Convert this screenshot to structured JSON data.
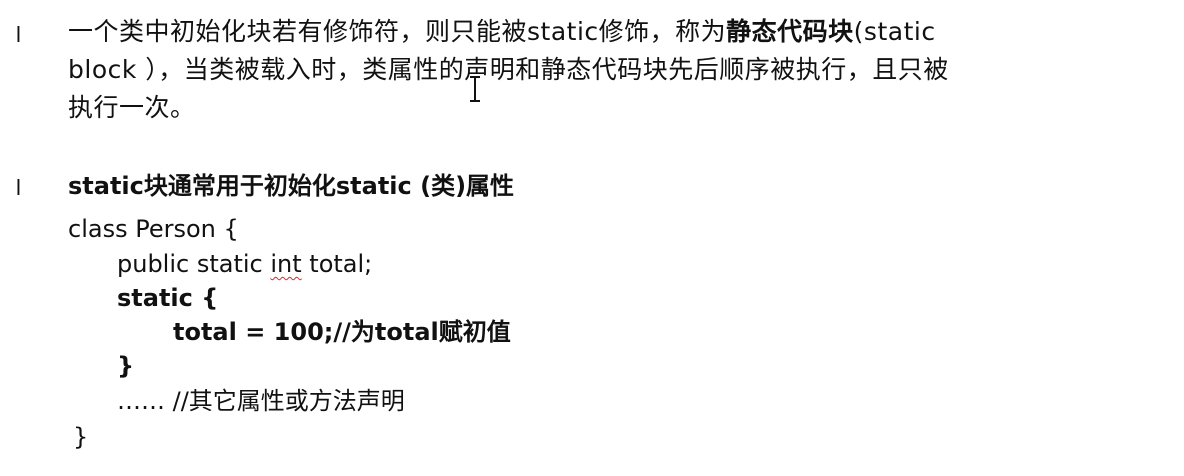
{
  "bullet_glyph": "l",
  "paragraph1": {
    "text_before": "一个类中初始化块若有修饰符，则只能被static修饰，称为",
    "bold_term": "静态代码块",
    "text_after_line1": "(static",
    "line2": "block ），当类被载入时，类属性的声明和静态代码块先后顺序被执行，且只被",
    "line3": "执行一次。"
  },
  "heading2": "static块通常用于初始化static (类)属性",
  "code": {
    "class_decl": "class Person {",
    "field_prefix": "public static ",
    "field_type": "int",
    "field_suffix": " total;",
    "static_open": "static {",
    "assignment": "total = 100;//为total赋初值",
    "static_close": "}",
    "others": "…… //其它属性或方法声明",
    "class_close": "}"
  }
}
